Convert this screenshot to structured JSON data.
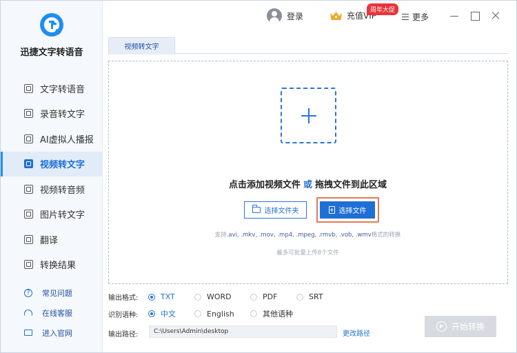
{
  "app": {
    "name": "迅捷文字转语音"
  },
  "sidebar": {
    "items": [
      {
        "label": "文字转语音",
        "icon": "text-to-speech-icon",
        "active": false
      },
      {
        "label": "录音转文字",
        "icon": "recording-to-text-icon",
        "active": false
      },
      {
        "label": "AI虚拟人播报",
        "icon": "ai-avatar-icon",
        "active": false
      },
      {
        "label": "视频转文字",
        "icon": "video-to-text-icon",
        "active": true
      },
      {
        "label": "视频转音频",
        "icon": "video-to-audio-icon",
        "active": false
      },
      {
        "label": "图片转文字",
        "icon": "image-to-text-icon",
        "active": false
      },
      {
        "label": "翻译",
        "icon": "translate-icon",
        "active": false
      },
      {
        "label": "转换结果",
        "icon": "results-icon",
        "active": false
      }
    ],
    "links": [
      {
        "label": "常见问题",
        "icon": "help-icon"
      },
      {
        "label": "在线客服",
        "icon": "headset-icon"
      },
      {
        "label": "进入官网",
        "icon": "website-icon"
      }
    ]
  },
  "topbar": {
    "login_label": "登录",
    "vip_label": "充值VIP",
    "vip_badge": "周年大促",
    "more_label": "更多"
  },
  "tabs": [
    {
      "label": "视频转文字"
    }
  ],
  "dropzone": {
    "prompt_a": "点击添加视频文件",
    "prompt_or": "或",
    "prompt_b": "拖拽文件到此区域",
    "select_folder_label": "选择文件夹",
    "select_file_label": "选择文件",
    "formats_prefix": "支持",
    "formats_list": ".avi, .mkv, .mov, .mp4, .mpeg, .rmvb, .vob, .wmv",
    "formats_suffix": "格式的转换",
    "limit_text": "最多可批量上传8个文件"
  },
  "options": {
    "format_label": "输出格式:",
    "formats": [
      "TXT",
      "WORD",
      "PDF",
      "SRT"
    ],
    "format_selected": "TXT",
    "language_label": "识别语种:",
    "languages": [
      "中文",
      "English",
      "其他语种"
    ],
    "language_selected": "中文",
    "path_label": "输出路径:",
    "path_value": "C:\\Users\\Admin\\desktop",
    "change_path_label": "更改路径",
    "start_label": "开始转换"
  },
  "colors": {
    "accent": "#1f6fd6",
    "badge": "#e8343b",
    "highlight_outline": "#e27a4f"
  }
}
